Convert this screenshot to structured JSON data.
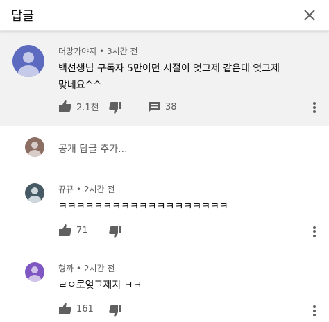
{
  "header": {
    "title": "답글",
    "close_icon": "close-icon"
  },
  "parent_comment": {
    "author": "더망가야지",
    "time": "3시간 전",
    "text_line1": "백선생님 구독자 5만이던 시절이 엊그제 같은데 엊그제",
    "text_line2": "맞네요^^",
    "likes": "2.1천",
    "reply_count": "38",
    "avatar_color": "#5c6bc0"
  },
  "add_reply": {
    "placeholder": "공개 답글 추가...",
    "avatar_color": "#8d6e63"
  },
  "replies": [
    {
      "author": "뀨뀨",
      "time": "2시간 전",
      "text": "ㅋㅋㅋㅋㅋㅋㅋㅋㅋㅋㅋㅋㅋㅋㅋㅋㅋㅋㅋ",
      "likes": "71",
      "avatar_color": "#455a64"
    },
    {
      "author": "형까",
      "time": "2시간 전",
      "text": "ㄹㅇ로엊그제지 ㅋㅋ",
      "likes": "161",
      "avatar_color": "#7e57c2"
    }
  ],
  "separator": "•"
}
